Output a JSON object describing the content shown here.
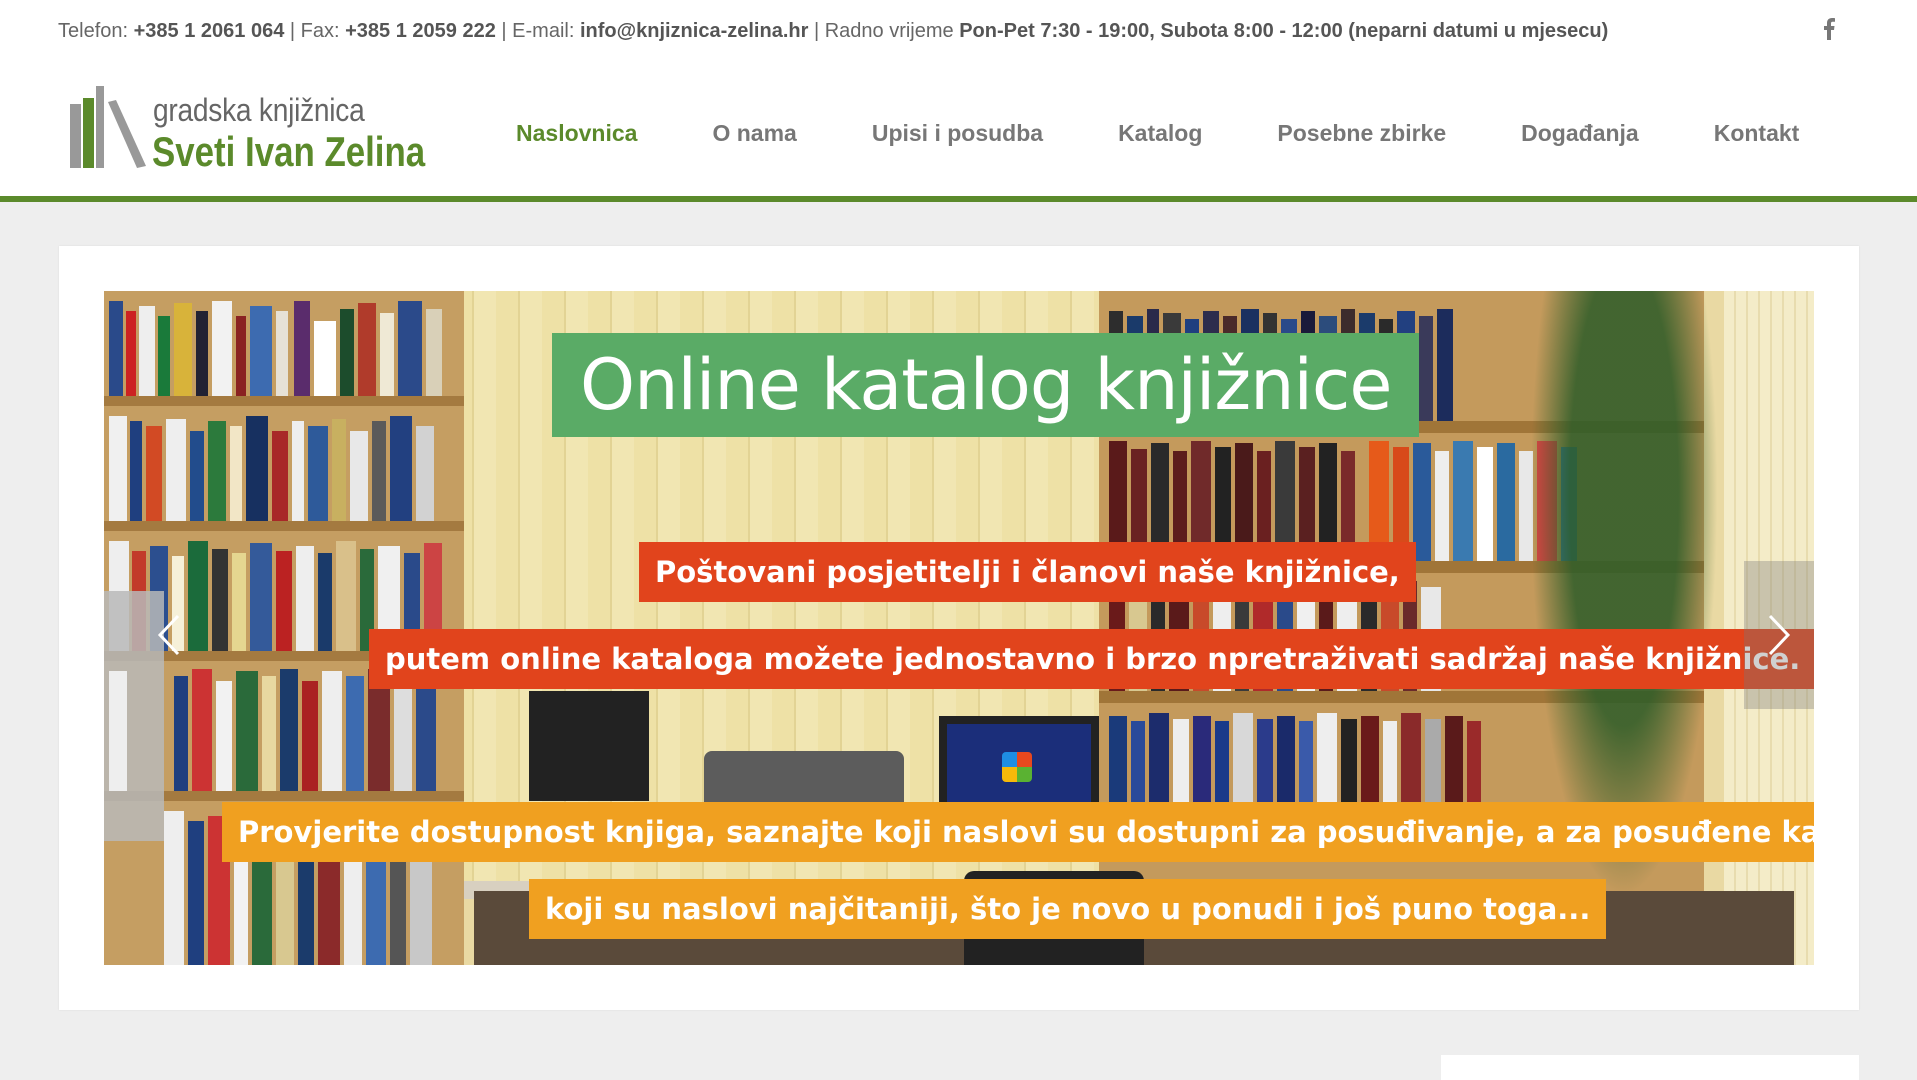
{
  "topbar": {
    "phone_label": "Telefon:",
    "phone": "+385 1 2061 064",
    "sep1": "|",
    "fax_label": "Fax:",
    "fax": "+385 1 2059 222",
    "sep2": "|",
    "email_label": "E-mail:",
    "email": "info@knjiznica-zelina.hr",
    "sep3": "|",
    "hours_label": "Radno vrijeme",
    "hours": "Pon-Pet  7:30 - 19:00, Subota  8:00 - 12:00 (neparni datumi u mjesecu)",
    "social_icon": "facebook-icon"
  },
  "logo": {
    "line1": "gradska knjižnica",
    "line2": "Sveti Ivan Zelina"
  },
  "nav": {
    "items": [
      {
        "label": "Naslovnica",
        "active": true
      },
      {
        "label": "O nama",
        "active": false
      },
      {
        "label": "Upisi i posudba",
        "active": false
      },
      {
        "label": "Katalog",
        "active": false
      },
      {
        "label": "Posebne zbirke",
        "active": false
      },
      {
        "label": "Događanja",
        "active": false
      },
      {
        "label": "Kontakt",
        "active": false
      }
    ]
  },
  "slider": {
    "title": "Online katalog knjižnice",
    "line1": "Poštovani posjetitelji i članovi naše knjižnice,",
    "line2": "putem online kataloga možete jednostavno i brzo npretraživati sadržaj naše knjižnice.",
    "line3": "Provjerite dostupnost knjiga, saznajte koji naslovi su dostupni za posuđivanje, a za posuđene kad će biti v",
    "line4": "koji su naslovi najčitaniji, što je novo u ponudi i još puno toga...",
    "prev_icon": "chevron-left-icon",
    "next_icon": "chevron-right-icon"
  },
  "colors": {
    "brand_green": "#5b8a2b",
    "title_green": "#5aab66",
    "caption_red": "#e1441c",
    "caption_orange": "#f0a020"
  }
}
